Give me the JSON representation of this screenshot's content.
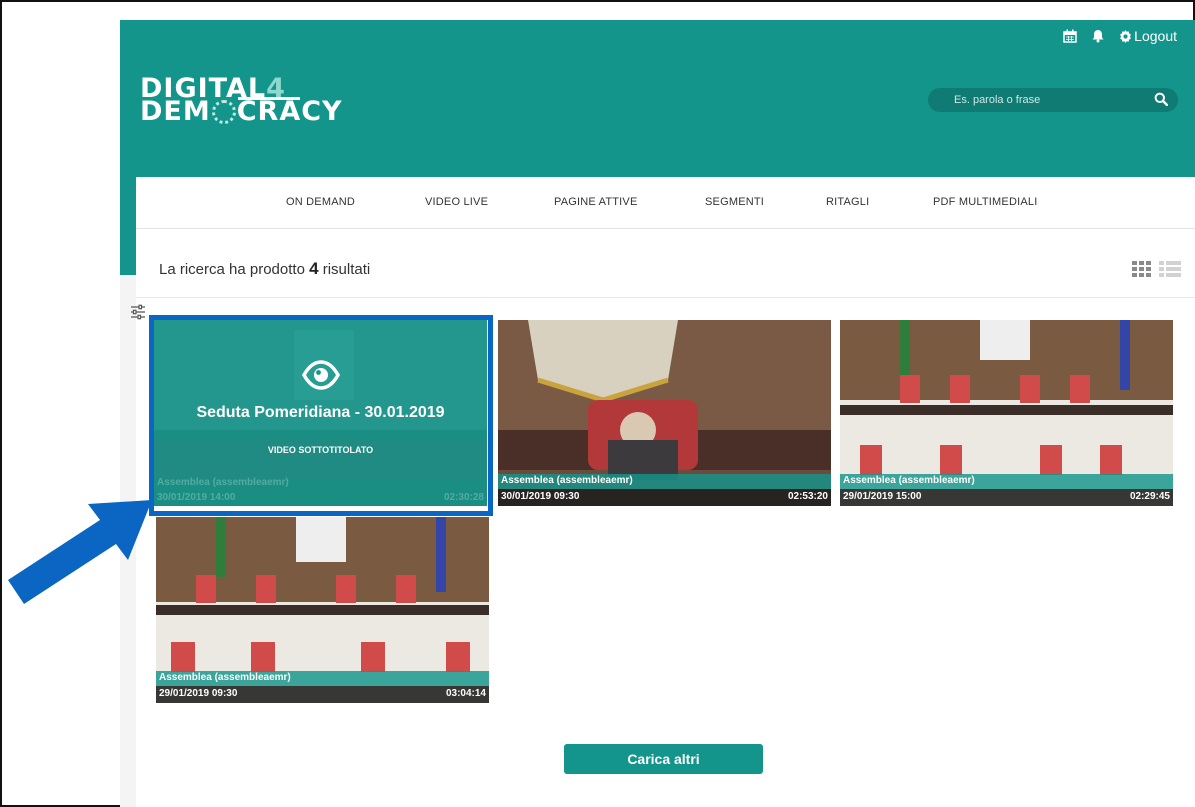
{
  "header": {
    "logo_line1": "DIGITAL",
    "logo_four": "4",
    "logo_line2_a": "DEM",
    "logo_line2_b": "CRACY",
    "logout_label": "Logout",
    "calendar_icon": "calendar-icon",
    "bell_icon": "bell-icon",
    "gear_icon": "gear-icon",
    "search_placeholder": "Es. parola o frase",
    "brand_color": "#13958b"
  },
  "nav": {
    "items": [
      {
        "label": "ON DEMAND"
      },
      {
        "label": "VIDEO LIVE"
      },
      {
        "label": "PAGINE ATTIVE"
      },
      {
        "label": "SEGMENTI"
      },
      {
        "label": "RITAGLI"
      },
      {
        "label": "PDF MULTIMEDIALI"
      }
    ]
  },
  "results": {
    "prefix": "La ricerca ha prodotto",
    "count": "4",
    "suffix": "risultati"
  },
  "videos": [
    {
      "overlay_title": "Seduta Pomeridiana - 30.01.2019",
      "overlay_subtitle": "VIDEO SOTTOTITOLATO",
      "channel": "Assemblea (assembleaemr)",
      "date": "30/01/2019 14:00",
      "duration": "02:30:28"
    },
    {
      "channel": "Assemblea (assembleaemr)",
      "date": "30/01/2019 09:30",
      "duration": "02:53:20"
    },
    {
      "channel": "Assemblea (assembleaemr)",
      "date": "29/01/2019 15:00",
      "duration": "02:29:45"
    },
    {
      "channel": "Assemblea (assembleaemr)",
      "date": "29/01/2019 09:30",
      "duration": "03:04:14"
    }
  ],
  "load_more_label": "Carica altri",
  "annotation_color": "#0a66c2"
}
